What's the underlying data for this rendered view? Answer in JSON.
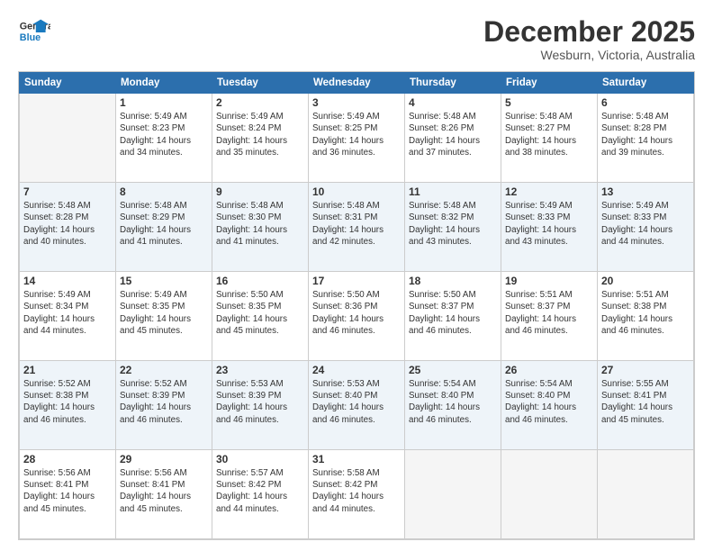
{
  "logo": {
    "line1": "General",
    "line2": "Blue"
  },
  "title": "December 2025",
  "subtitle": "Wesburn, Victoria, Australia",
  "headers": [
    "Sunday",
    "Monday",
    "Tuesday",
    "Wednesday",
    "Thursday",
    "Friday",
    "Saturday"
  ],
  "weeks": [
    [
      {
        "day": "",
        "empty": true,
        "sunrise": "",
        "sunset": "",
        "daylight": ""
      },
      {
        "day": "1",
        "sunrise": "Sunrise: 5:49 AM",
        "sunset": "Sunset: 8:23 PM",
        "daylight": "Daylight: 14 hours and 34 minutes."
      },
      {
        "day": "2",
        "sunrise": "Sunrise: 5:49 AM",
        "sunset": "Sunset: 8:24 PM",
        "daylight": "Daylight: 14 hours and 35 minutes."
      },
      {
        "day": "3",
        "sunrise": "Sunrise: 5:49 AM",
        "sunset": "Sunset: 8:25 PM",
        "daylight": "Daylight: 14 hours and 36 minutes."
      },
      {
        "day": "4",
        "sunrise": "Sunrise: 5:48 AM",
        "sunset": "Sunset: 8:26 PM",
        "daylight": "Daylight: 14 hours and 37 minutes."
      },
      {
        "day": "5",
        "sunrise": "Sunrise: 5:48 AM",
        "sunset": "Sunset: 8:27 PM",
        "daylight": "Daylight: 14 hours and 38 minutes."
      },
      {
        "day": "6",
        "sunrise": "Sunrise: 5:48 AM",
        "sunset": "Sunset: 8:28 PM",
        "daylight": "Daylight: 14 hours and 39 minutes."
      }
    ],
    [
      {
        "day": "7",
        "sunrise": "Sunrise: 5:48 AM",
        "sunset": "Sunset: 8:28 PM",
        "daylight": "Daylight: 14 hours and 40 minutes."
      },
      {
        "day": "8",
        "sunrise": "Sunrise: 5:48 AM",
        "sunset": "Sunset: 8:29 PM",
        "daylight": "Daylight: 14 hours and 41 minutes."
      },
      {
        "day": "9",
        "sunrise": "Sunrise: 5:48 AM",
        "sunset": "Sunset: 8:30 PM",
        "daylight": "Daylight: 14 hours and 41 minutes."
      },
      {
        "day": "10",
        "sunrise": "Sunrise: 5:48 AM",
        "sunset": "Sunset: 8:31 PM",
        "daylight": "Daylight: 14 hours and 42 minutes."
      },
      {
        "day": "11",
        "sunrise": "Sunrise: 5:48 AM",
        "sunset": "Sunset: 8:32 PM",
        "daylight": "Daylight: 14 hours and 43 minutes."
      },
      {
        "day": "12",
        "sunrise": "Sunrise: 5:49 AM",
        "sunset": "Sunset: 8:33 PM",
        "daylight": "Daylight: 14 hours and 43 minutes."
      },
      {
        "day": "13",
        "sunrise": "Sunrise: 5:49 AM",
        "sunset": "Sunset: 8:33 PM",
        "daylight": "Daylight: 14 hours and 44 minutes."
      }
    ],
    [
      {
        "day": "14",
        "sunrise": "Sunrise: 5:49 AM",
        "sunset": "Sunset: 8:34 PM",
        "daylight": "Daylight: 14 hours and 44 minutes."
      },
      {
        "day": "15",
        "sunrise": "Sunrise: 5:49 AM",
        "sunset": "Sunset: 8:35 PM",
        "daylight": "Daylight: 14 hours and 45 minutes."
      },
      {
        "day": "16",
        "sunrise": "Sunrise: 5:50 AM",
        "sunset": "Sunset: 8:35 PM",
        "daylight": "Daylight: 14 hours and 45 minutes."
      },
      {
        "day": "17",
        "sunrise": "Sunrise: 5:50 AM",
        "sunset": "Sunset: 8:36 PM",
        "daylight": "Daylight: 14 hours and 46 minutes."
      },
      {
        "day": "18",
        "sunrise": "Sunrise: 5:50 AM",
        "sunset": "Sunset: 8:37 PM",
        "daylight": "Daylight: 14 hours and 46 minutes."
      },
      {
        "day": "19",
        "sunrise": "Sunrise: 5:51 AM",
        "sunset": "Sunset: 8:37 PM",
        "daylight": "Daylight: 14 hours and 46 minutes."
      },
      {
        "day": "20",
        "sunrise": "Sunrise: 5:51 AM",
        "sunset": "Sunset: 8:38 PM",
        "daylight": "Daylight: 14 hours and 46 minutes."
      }
    ],
    [
      {
        "day": "21",
        "sunrise": "Sunrise: 5:52 AM",
        "sunset": "Sunset: 8:38 PM",
        "daylight": "Daylight: 14 hours and 46 minutes."
      },
      {
        "day": "22",
        "sunrise": "Sunrise: 5:52 AM",
        "sunset": "Sunset: 8:39 PM",
        "daylight": "Daylight: 14 hours and 46 minutes."
      },
      {
        "day": "23",
        "sunrise": "Sunrise: 5:53 AM",
        "sunset": "Sunset: 8:39 PM",
        "daylight": "Daylight: 14 hours and 46 minutes."
      },
      {
        "day": "24",
        "sunrise": "Sunrise: 5:53 AM",
        "sunset": "Sunset: 8:40 PM",
        "daylight": "Daylight: 14 hours and 46 minutes."
      },
      {
        "day": "25",
        "sunrise": "Sunrise: 5:54 AM",
        "sunset": "Sunset: 8:40 PM",
        "daylight": "Daylight: 14 hours and 46 minutes."
      },
      {
        "day": "26",
        "sunrise": "Sunrise: 5:54 AM",
        "sunset": "Sunset: 8:40 PM",
        "daylight": "Daylight: 14 hours and 46 minutes."
      },
      {
        "day": "27",
        "sunrise": "Sunrise: 5:55 AM",
        "sunset": "Sunset: 8:41 PM",
        "daylight": "Daylight: 14 hours and 45 minutes."
      }
    ],
    [
      {
        "day": "28",
        "sunrise": "Sunrise: 5:56 AM",
        "sunset": "Sunset: 8:41 PM",
        "daylight": "Daylight: 14 hours and 45 minutes."
      },
      {
        "day": "29",
        "sunrise": "Sunrise: 5:56 AM",
        "sunset": "Sunset: 8:41 PM",
        "daylight": "Daylight: 14 hours and 45 minutes."
      },
      {
        "day": "30",
        "sunrise": "Sunrise: 5:57 AM",
        "sunset": "Sunset: 8:42 PM",
        "daylight": "Daylight: 14 hours and 44 minutes."
      },
      {
        "day": "31",
        "sunrise": "Sunrise: 5:58 AM",
        "sunset": "Sunset: 8:42 PM",
        "daylight": "Daylight: 14 hours and 44 minutes."
      },
      {
        "day": "",
        "empty": true,
        "sunrise": "",
        "sunset": "",
        "daylight": ""
      },
      {
        "day": "",
        "empty": true,
        "sunrise": "",
        "sunset": "",
        "daylight": ""
      },
      {
        "day": "",
        "empty": true,
        "sunrise": "",
        "sunset": "",
        "daylight": ""
      }
    ]
  ]
}
